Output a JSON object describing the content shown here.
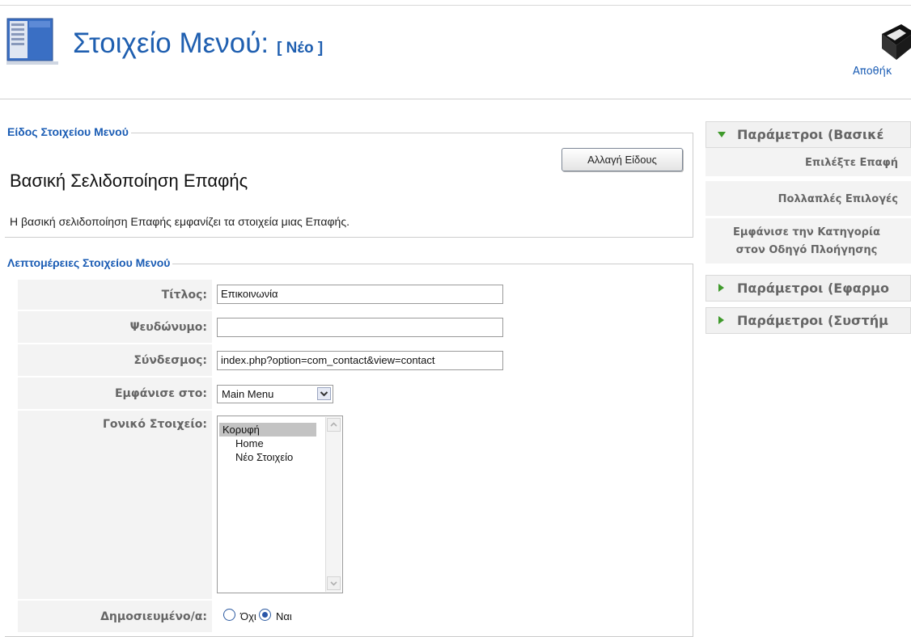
{
  "header": {
    "title": "Στοιχείο Μενού:",
    "subtitle": "[ Νέο ]",
    "save_label": "Αποθήκ"
  },
  "type_section": {
    "legend": "Είδος Στοιχείου Μενού",
    "change_button": "Αλλαγή Είδους",
    "type_title": "Βασική Σελιδοποίηση Επαφής",
    "description": "Η βασική σελιδοποίηση Επαφής εμφανίζει τα στοιχεία μιας Επαφής."
  },
  "details": {
    "legend": "Λεπτομέρειες Στοιχείου Μενού",
    "title_label": "Τίτλος:",
    "title_value": "Επικοινωνία",
    "alias_label": "Ψευδώνυμο:",
    "alias_value": "",
    "link_label": "Σύνδεσμος:",
    "link_value": "index.php?option=com_contact&view=contact",
    "display_label": "Εμφάνισε στο:",
    "display_value": "Main Menu",
    "parent_label": "Γονικό Στοιχείο:",
    "parent_items": [
      "Κορυφή",
      "Home",
      "Νέο Στοιχείο"
    ],
    "published_label": "Δημοσιευμένο/α:",
    "published_no": "Όχι",
    "published_yes": "Ναι"
  },
  "params": {
    "basic_header": "Παράμετροι (Βασικέ",
    "select_contact": "Επιλέξτε Επαφή",
    "multiple_options": "Πολλαπλές Επιλογές",
    "show_category_1": "Εμφάνισε την Κατηγορία",
    "show_category_2": "στον Οδηγό Πλοήγησης",
    "app_header": "Παράμετροι (Εφαρμο",
    "system_header": "Παράμετροι (Συστήμ"
  },
  "colors": {
    "accent_blue": "#1a5cb4",
    "expand_green": "#3f9a2b",
    "label_gray": "#666666"
  }
}
